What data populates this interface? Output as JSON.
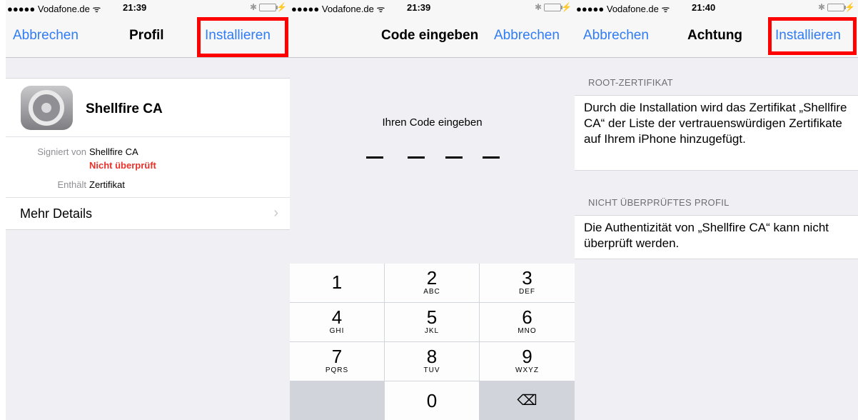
{
  "screen1": {
    "status": {
      "carrier": "●●●●● Vodafone.de ᯤ",
      "time": "21:39"
    },
    "nav": {
      "left": "Abbrechen",
      "title": "Profil",
      "right": "Installieren"
    },
    "profile": {
      "name": "Shellfire CA",
      "icon": "settings-gear-icon"
    },
    "details": {
      "signed_label": "Signiert von",
      "signed_value": "Shellfire CA",
      "verified_status": "Nicht überprüft",
      "contains_label": "Enthält",
      "contains_value": "Zertifikat"
    },
    "more_details": "Mehr Details",
    "chevron": "›"
  },
  "screen2": {
    "status": {
      "carrier": "●●●●● Vodafone.de ᯤ",
      "time": "21:39"
    },
    "nav": {
      "title": "Code eingeben",
      "right": "Abbrechen"
    },
    "prompt": "Ihren Code eingeben",
    "code_placeholder": [
      "–",
      "–",
      "–",
      "–"
    ],
    "keys": [
      {
        "num": "1",
        "letters": ""
      },
      {
        "num": "2",
        "letters": "ABC"
      },
      {
        "num": "3",
        "letters": "DEF"
      },
      {
        "num": "4",
        "letters": "GHI"
      },
      {
        "num": "5",
        "letters": "JKL"
      },
      {
        "num": "6",
        "letters": "MNO"
      },
      {
        "num": "7",
        "letters": "PQRS"
      },
      {
        "num": "8",
        "letters": "TUV"
      },
      {
        "num": "9",
        "letters": "WXYZ"
      },
      {
        "num": "",
        "letters": ""
      },
      {
        "num": "0",
        "letters": ""
      },
      {
        "num": "⌫",
        "letters": ""
      }
    ]
  },
  "screen3": {
    "status": {
      "carrier": "●●●●● Vodafone.de ᯤ",
      "time": "21:40"
    },
    "nav": {
      "left": "Abbrechen",
      "title": "Achtung",
      "right": "Installieren"
    },
    "section1": {
      "header": "ROOT-ZERTIFIKAT",
      "body": "Durch die Installation wird das Zertifikat „Shellfire CA“ der Liste der vertrauenswürdigen Zertifikate auf Ihrem iPhone hinzugefügt."
    },
    "section2": {
      "header": "NICHT ÜBERPRÜFTES PROFIL",
      "body": "Die Authentizität von „Shellfire CA“ kann nicht überprüft werden."
    }
  },
  "colors": {
    "accent": "#2f7cf6",
    "highlight": "#ff0000",
    "warning": "#e8312a"
  }
}
